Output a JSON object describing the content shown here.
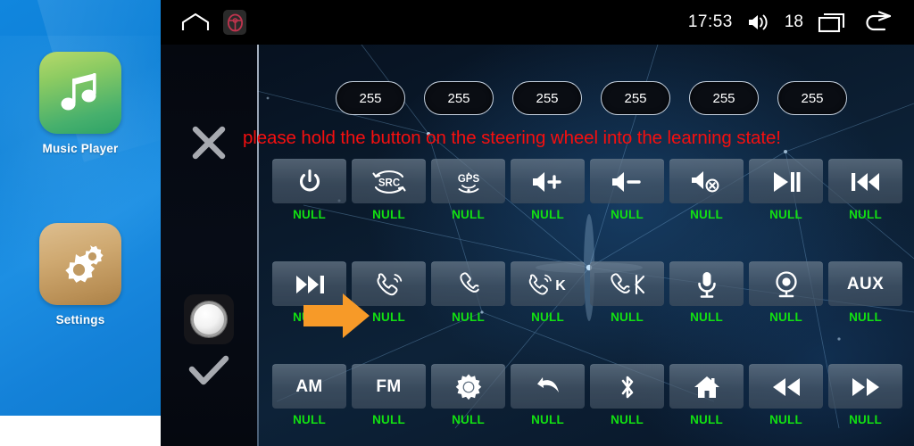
{
  "launcher": {
    "apps": [
      {
        "label": "Music Player",
        "icon": "music-note-icon"
      },
      {
        "label": "Settings",
        "icon": "gears-icon"
      }
    ]
  },
  "statusbar": {
    "home_icon": "home-outline-icon",
    "steering_wheel_icon": "steering-wheel-icon",
    "time": "17:53",
    "volume_icon": "volume-icon",
    "volume_value": "18",
    "recents_icon": "recent-apps-icon",
    "back_icon": "back-arrow-icon"
  },
  "rail": {
    "cancel_icon": "close-x-icon",
    "knob_icon": "rotary-knob-icon",
    "confirm_icon": "checkmark-icon"
  },
  "pills": {
    "values": [
      "255",
      "255",
      "255",
      "255",
      "255",
      "255"
    ]
  },
  "message": {
    "warning": "please hold the button on the steering wheel into the learning state!",
    "warning_color": "#f60f0f"
  },
  "grid": {
    "unassigned_label": "NULL",
    "label_color": "#12e012",
    "rows": [
      [
        {
          "icon": "power-icon",
          "text": "",
          "label": "NULL"
        },
        {
          "icon": "src-icon",
          "text": "SRC",
          "label": "NULL"
        },
        {
          "icon": "gps-icon",
          "text": "GPS",
          "label": "NULL"
        },
        {
          "icon": "volume-up-icon",
          "text": "",
          "label": "NULL"
        },
        {
          "icon": "volume-down-icon",
          "text": "",
          "label": "NULL"
        },
        {
          "icon": "volume-mute-icon",
          "text": "",
          "label": "NULL"
        },
        {
          "icon": "play-pause-icon",
          "text": "",
          "label": "NULL"
        },
        {
          "icon": "previous-track-icon",
          "text": "",
          "label": "NULL"
        }
      ],
      [
        {
          "icon": "next-track-icon",
          "text": "",
          "label": "NULL"
        },
        {
          "icon": "answer-call-icon",
          "text": "",
          "label": "NULL"
        },
        {
          "icon": "end-call-icon",
          "text": "",
          "label": "NULL"
        },
        {
          "icon": "call-k-icon",
          "text": "K",
          "label": "NULL"
        },
        {
          "icon": "call-transfer-icon",
          "text": "",
          "label": "NULL"
        },
        {
          "icon": "microphone-icon",
          "text": "",
          "label": "NULL"
        },
        {
          "icon": "camera-icon",
          "text": "",
          "label": "NULL"
        },
        {
          "icon": "aux-icon",
          "text": "AUX",
          "label": "NULL"
        }
      ],
      [
        {
          "icon": "am-icon",
          "text": "AM",
          "label": "NULL"
        },
        {
          "icon": "fm-icon",
          "text": "FM",
          "label": "NULL"
        },
        {
          "icon": "brightness-icon",
          "text": "",
          "label": "NULL"
        },
        {
          "icon": "back-return-icon",
          "text": "",
          "label": "NULL"
        },
        {
          "icon": "bluetooth-icon",
          "text": "",
          "label": "NULL"
        },
        {
          "icon": "home-icon",
          "text": "",
          "label": "NULL"
        },
        {
          "icon": "rewind-icon",
          "text": "",
          "label": "NULL"
        },
        {
          "icon": "fast-forward-icon",
          "text": "",
          "label": "NULL"
        }
      ]
    ]
  },
  "colors": {
    "accent_orange": "#f79a28",
    "panel_blue": "#0d2238",
    "sidebar_blue": "#1186de",
    "green": "#12e012",
    "red": "#f60f0f"
  }
}
